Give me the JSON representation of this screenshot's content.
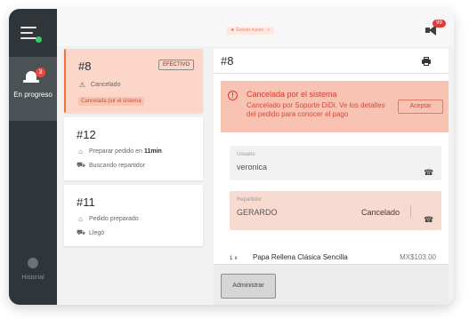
{
  "sidebar": {
    "nav_items": [
      {
        "label": "En progreso",
        "badge": "3",
        "active": true
      },
      {
        "label": "Historial",
        "active": false
      }
    ]
  },
  "topbar": {
    "mode_chip": {
      "label": "Evento nuevo"
    },
    "notification_count": "99"
  },
  "orders": [
    {
      "number": "#8",
      "payment_badge": "EFECTIVO",
      "status": "Cancelado",
      "cancel_note": "Cancelada por el sistema",
      "selected": true
    },
    {
      "number": "#12",
      "prep_label": "Preparar pedido en",
      "prep_time": "11min",
      "courier_status": "Buscando repartidor"
    },
    {
      "number": "#11",
      "prep_label": "Pedido preparado",
      "courier_status": "Llegó"
    }
  ],
  "detail": {
    "title": "#8",
    "banner": {
      "title": "Cancelada por el sistema",
      "text": "Cancelado por Soporte DiDi. Ve los detalles del pedido para conocer el pago",
      "accept_label": "Aceptar"
    },
    "user": {
      "label": "Usuario",
      "value": "veronica"
    },
    "courier": {
      "label": "Repartidor",
      "value": "GERARDO",
      "status": "Cancelado"
    },
    "items": [
      {
        "qty": "1",
        "unit": "x",
        "name": "Papa Rellena Clásica Sencilla",
        "price": "MX$103.00"
      }
    ],
    "admin_label": "Administrar"
  },
  "colors": {
    "sidebar": "#2f3538",
    "sidebar_active": "#4a5255",
    "selected_card": "#fbd6c9",
    "accent": "#f0713e",
    "banner": "#f9c3b3",
    "alert_text": "#d23a2e",
    "online_dot": "#33cc66"
  },
  "icons": {
    "menu": "hamburger-menu-icon",
    "in_progress": "bell-icon",
    "history": "clock-icon",
    "alerts": "megaphone-icon",
    "print": "printer-icon",
    "warning": "warning-triangle-icon",
    "phone": "phone-icon",
    "bag": "bag-icon",
    "courier": "scooter-icon"
  }
}
